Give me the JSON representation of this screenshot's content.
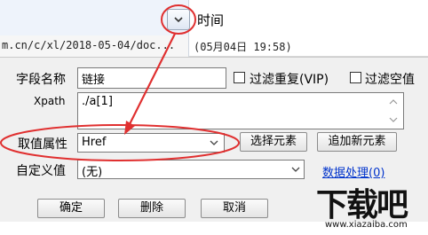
{
  "table": {
    "column_title": "时间",
    "row_url": "m.cn/c/xl/2018-05-04/doc...",
    "row_date": "(05月04日 19:58)"
  },
  "dialog": {
    "field_name_label": "字段名称",
    "field_name_value": "链接",
    "filter_dup_label": "过滤重复(VIP)",
    "filter_empty_label": "过滤空值",
    "xpath_label": "Xpath",
    "xpath_value": "./a[1]",
    "attr_label": "取值属性",
    "attr_value": "Href",
    "select_element_button": "选择元素",
    "add_element_button": "追加新元素",
    "custom_value_label": "自定义值",
    "custom_value_value": "(无)",
    "data_processing_link": "数据处理(0)",
    "ok_button": "确定",
    "delete_button": "删除",
    "cancel_button": "取消"
  },
  "watermark": {
    "brand": "下载吧",
    "url": "www.xiazaiba.com"
  },
  "colors": {
    "highlight_red": "#e03030",
    "link_blue": "#0033cc"
  }
}
